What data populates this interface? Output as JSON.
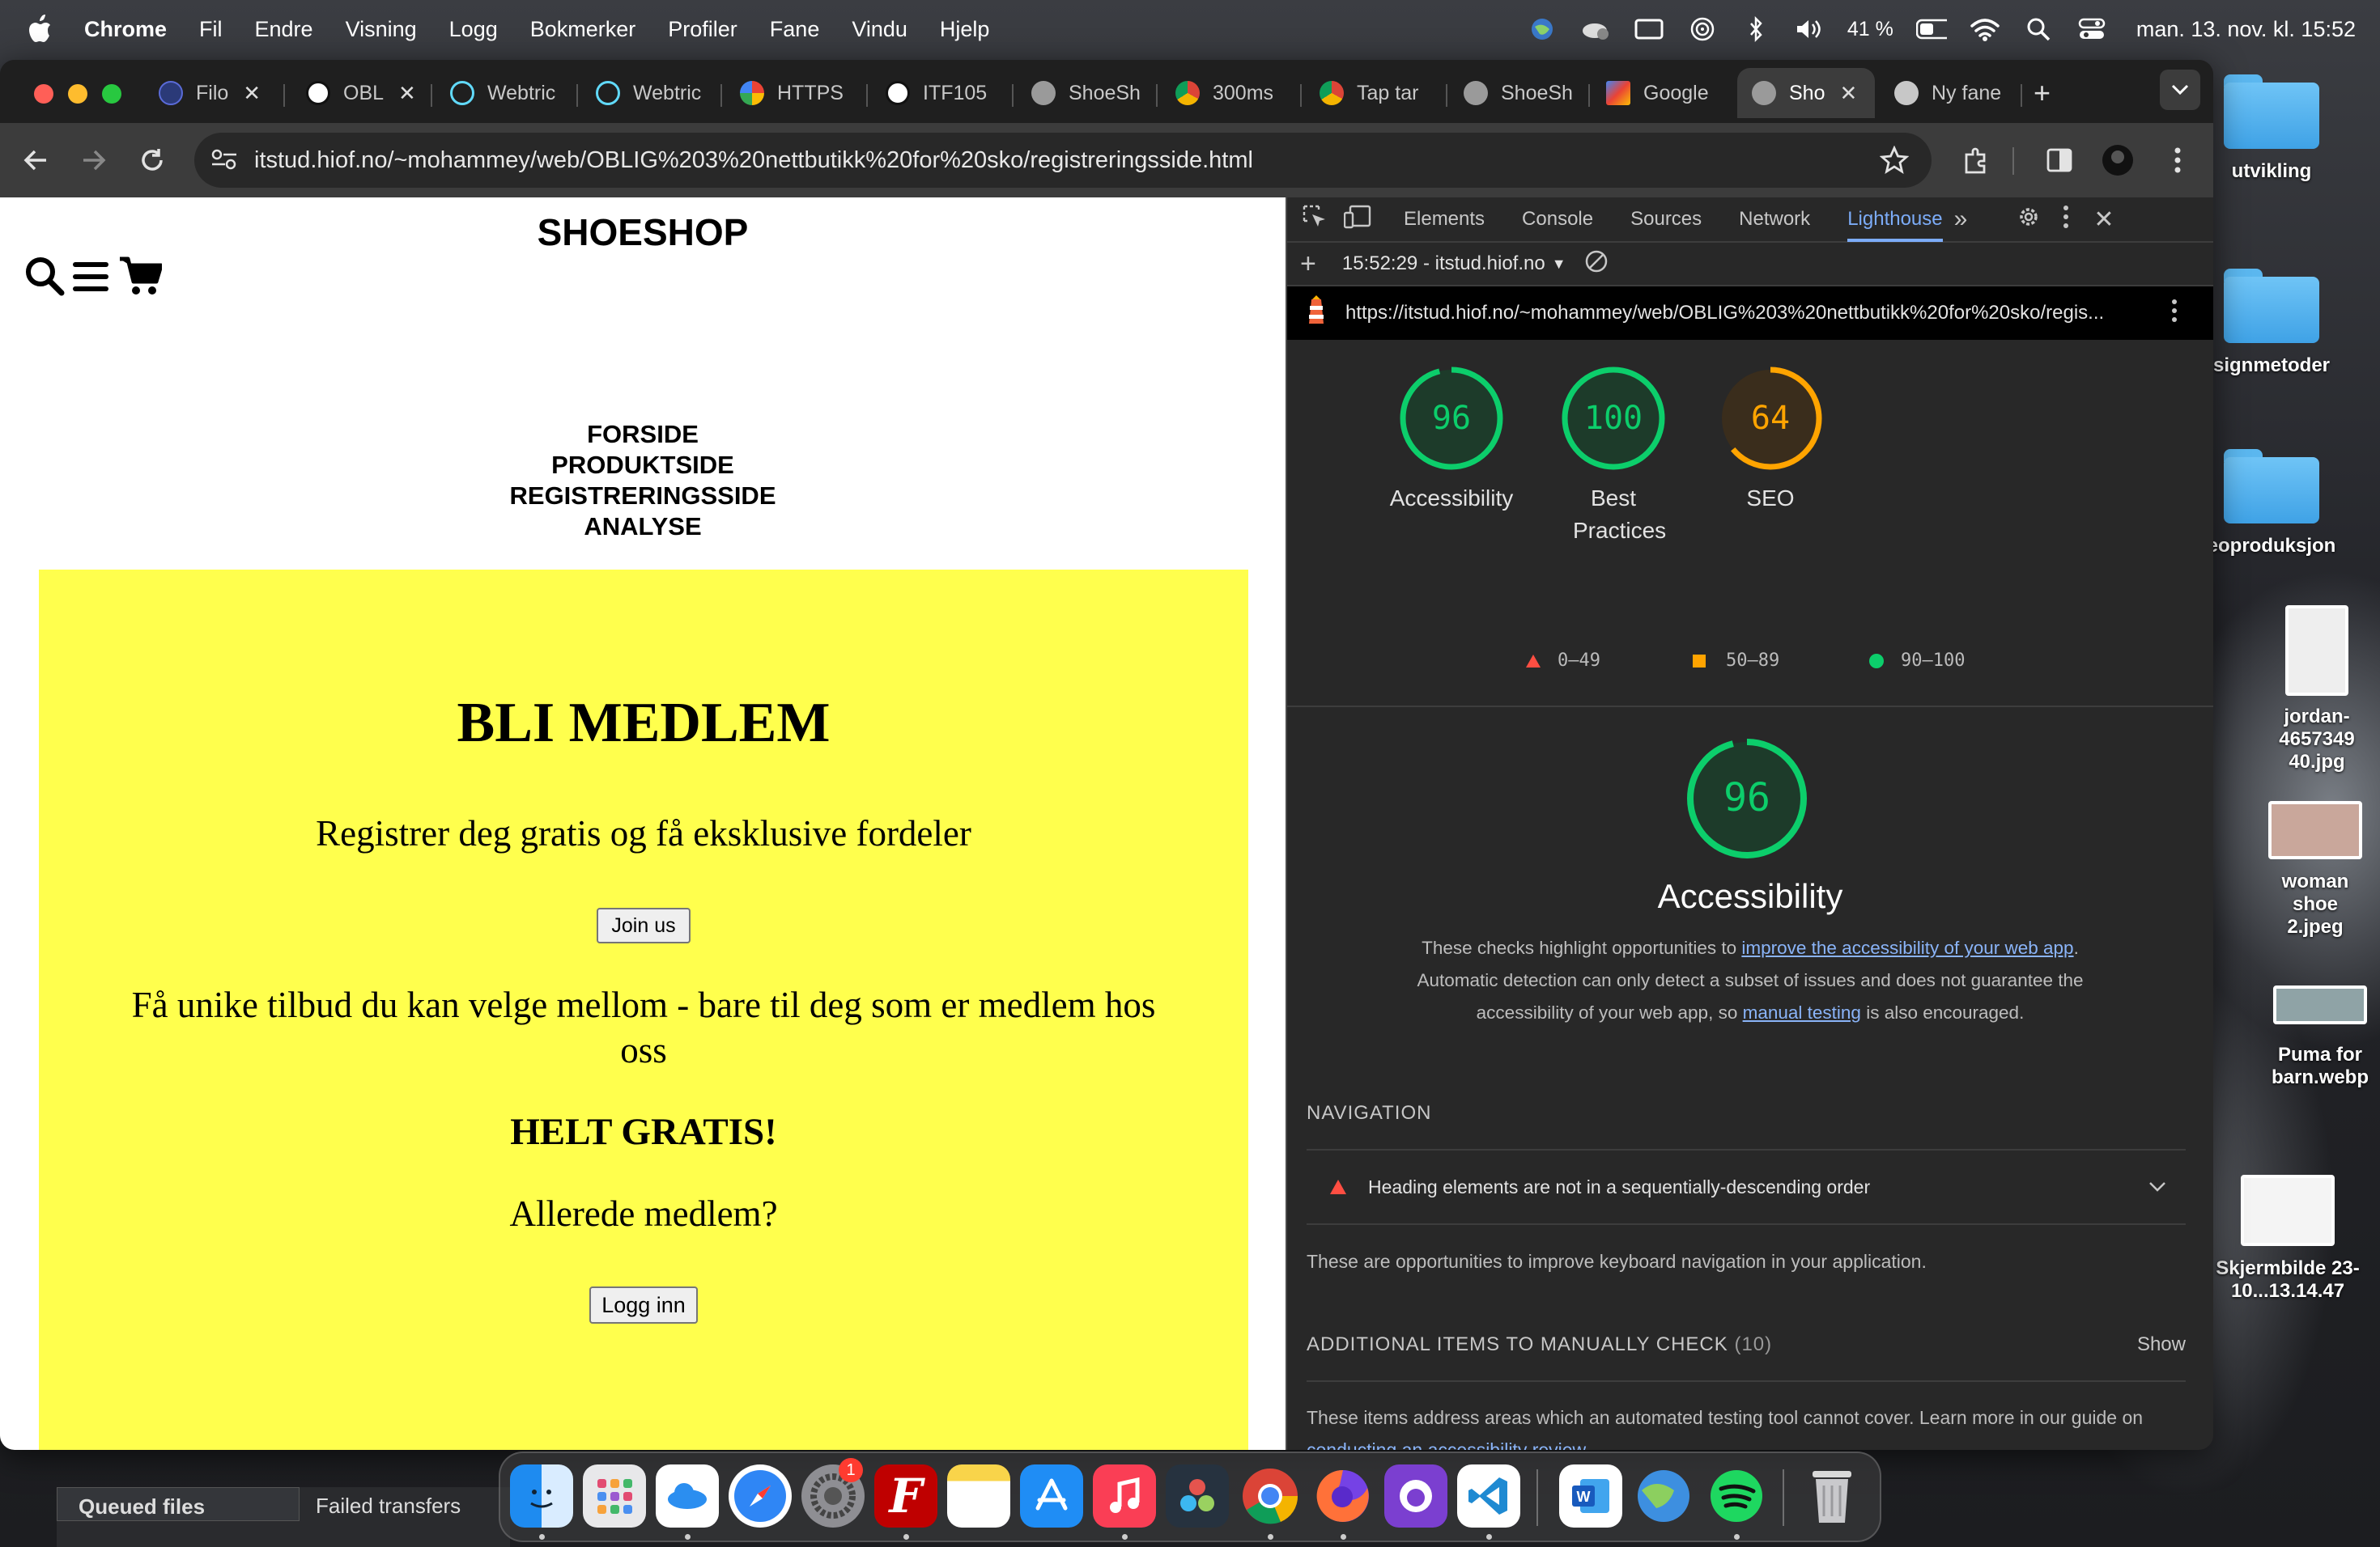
{
  "menubar": {
    "app": "Chrome",
    "items": [
      "Fil",
      "Endre",
      "Visning",
      "Logg",
      "Bokmerker",
      "Profiler",
      "Fane",
      "Vindu",
      "Hjelp"
    ],
    "battery": "41 %",
    "clock": "man. 13. nov. kl. 15:52"
  },
  "desktop": {
    "items": [
      "utvikling",
      "signmetoder",
      "eoproduksjon",
      "jordan-4657349 40.jpg",
      "woman shoe 2.jpeg",
      "Puma for barn.webp",
      "Skjermbilde 23-10...13.14.47"
    ]
  },
  "browser": {
    "tabs": [
      {
        "label": "Filo",
        "icon": "figma-icon"
      },
      {
        "label": "OBL",
        "icon": "notion-icon"
      },
      {
        "label": "Webtric",
        "icon": "react-icon"
      },
      {
        "label": "Webtric",
        "icon": "react-icon"
      },
      {
        "label": "HTTPS",
        "icon": "google-icon"
      },
      {
        "label": "ITF105",
        "icon": "notion-icon"
      },
      {
        "label": "ShoeSh",
        "icon": "globe-icon"
      },
      {
        "label": "300ms",
        "icon": "chrome-icon"
      },
      {
        "label": "Tap tar",
        "icon": "chrome-icon"
      },
      {
        "label": "ShoeSh",
        "icon": "globe-icon"
      },
      {
        "label": "Google",
        "icon": "google-analytics-icon"
      },
      {
        "label": "Sho",
        "icon": "globe-icon"
      },
      {
        "label": "Ny fane",
        "icon": "chrome-icon"
      }
    ],
    "url": "itstud.hiof.no/~mohammey/web/OBLIG%203%20nettbutikk%20for%20sko/registreringsside.html"
  },
  "page": {
    "brand": "SHOESHOP",
    "nav": [
      "FORSIDE",
      "PRODUKTSIDE",
      "REGISTRERINGSSIDE",
      "ANALYSE"
    ],
    "heading": "BLI MEDLEM",
    "intro": "Registrer deg gratis og få eksklusive fordeler",
    "join_button": "Join us",
    "offer": "Få unike tilbud du kan velge mellom - bare til deg som er medlem hos oss",
    "free": "HELT GRATIS!",
    "already": "Allerede medlem?",
    "login_button": "Logg inn",
    "panel_color": "#ffff4d"
  },
  "devtools": {
    "tabs": [
      "Elements",
      "Console",
      "Sources",
      "Network",
      "Lighthouse"
    ],
    "selected_tab": "Lighthouse",
    "report_time": "15:52:29 - itstud.hiof.no",
    "report_url": "https://itstud.hiof.no/~mohammey/web/OBLIG%203%20nettbutikk%20for%20sko/regis...",
    "scores": [
      {
        "value": "96",
        "label": "Accessibility",
        "color": "#0cce6b",
        "fraction": 0.96
      },
      {
        "value": "100",
        "label": "Best Practices",
        "color": "#0cce6b",
        "fraction": 1.0
      },
      {
        "value": "64",
        "label": "SEO",
        "color": "#ffa400",
        "fraction": 0.64
      }
    ],
    "legend": [
      "0–49",
      "50–89",
      "90–100"
    ],
    "main_score": {
      "value": "96",
      "title": "Accessibility",
      "fraction": 0.96
    },
    "desc_pre": "These checks highlight opportunities to ",
    "desc_link1": "improve the accessibility of your web app",
    "desc_mid": ". Automatic detection can only detect a subset of issues and does not guarantee the accessibility of your web app, so ",
    "desc_link2": "manual testing",
    "desc_post": " is also encouraged.",
    "nav_heading": "NAVIGATION",
    "audit": "Heading elements are not in a sequentially-descending order",
    "nav_note": "These are opportunities to improve keyboard navigation in your application.",
    "manual_heading": "ADDITIONAL ITEMS TO MANUALLY CHECK",
    "manual_count": "(10)",
    "show": "Show",
    "manual_pre": "These items address areas which an automated testing tool cannot cover. Learn more in our guide on ",
    "manual_link": "conducting an accessibility review",
    "manual_post": "."
  },
  "filezilla": {
    "tabs": [
      "Queued files",
      "Failed transfers"
    ]
  },
  "dock": {
    "apps": [
      "Finder",
      "Launchpad",
      "iCloud Drive",
      "Safari",
      "System Settings",
      "FileZilla",
      "Notes",
      "App Store",
      "Music",
      "DaVinci Resolve",
      "Chrome",
      "Firefox",
      "GitHub Desktop",
      "VS Code",
      "Word",
      "Globe",
      "Spotify",
      "Trash"
    ],
    "settings_badge": "1"
  }
}
